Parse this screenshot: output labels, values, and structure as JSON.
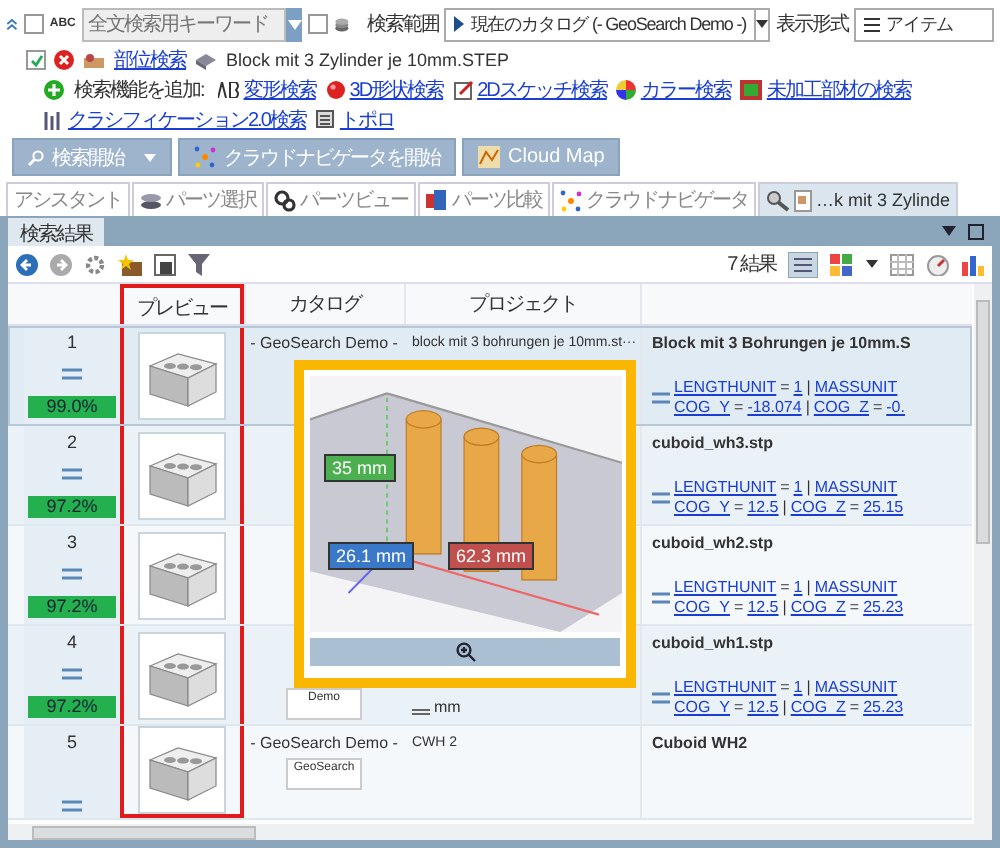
{
  "search_bar": {
    "abc_label": "ABC",
    "keyword_placeholder": "全文検索用キーワード",
    "keyword_checked": false,
    "option_checked": false,
    "scope_label": "検索範囲",
    "scope_value": "現在のカタログ (- GeoSearch Demo -)",
    "view_label": "表示形式",
    "view_value": "アイテム"
  },
  "active_search": {
    "checked": true,
    "link": "部位検索",
    "file": "Block mit 3 Zylinder je 10mm.STEP"
  },
  "add_functions": {
    "label": "検索機能を追加:",
    "links": [
      {
        "kind": "morph",
        "label": "変形検索"
      },
      {
        "kind": "shape3d",
        "label": "3D形状検索"
      },
      {
        "kind": "sketch",
        "label": "2Dスケッチ検索"
      },
      {
        "kind": "color",
        "label": "カラー検索"
      },
      {
        "kind": "raw",
        "label": "未加工部材の検索"
      },
      {
        "kind": "classification",
        "label": "クラシフィケーション2.0検索"
      },
      {
        "kind": "topology",
        "label": "トポロ"
      }
    ]
  },
  "actions": [
    {
      "kind": "search",
      "label": "検索開始",
      "menu": true
    },
    {
      "kind": "cloud",
      "label": "クラウドナビゲータを開始",
      "menu": false
    },
    {
      "kind": "map",
      "label": "Cloud Map",
      "menu": false
    }
  ],
  "tabs": [
    {
      "kind": "assistant",
      "label": "アシスタント",
      "selected": false
    },
    {
      "kind": "parts",
      "label": "パーツ選択",
      "selected": false
    },
    {
      "kind": "view",
      "label": "パーツビュー",
      "selected": false
    },
    {
      "kind": "compare",
      "label": "パーツ比較",
      "selected": false
    },
    {
      "kind": "cloud",
      "label": "クラウドナビゲータ",
      "selected": false
    },
    {
      "kind": "result",
      "label": "…k mit 3 Zylinde",
      "selected": true
    }
  ],
  "panel": {
    "tab": "検索結果",
    "result_count": "7 結果"
  },
  "table": {
    "columns": [
      "プレビュー",
      "カタログ",
      "プロジェクト"
    ],
    "rows": [
      {
        "number": "1",
        "score": "99.0%",
        "selected": true,
        "catalog": "- GeoSearch Demo -",
        "project": "block mit 3 bohrungen je 10mm.st···",
        "title": "Block mit 3 Bohrungen je 10mm.S",
        "props": [
          [
            {
              "kind": "link",
              "text": "LENGTHUNIT"
            },
            {
              "kind": "op",
              "text": "="
            },
            {
              "kind": "link",
              "text": "1"
            },
            {
              "kind": "op",
              "text": "|"
            },
            {
              "kind": "link",
              "text": "MASSUNIT"
            }
          ],
          [
            {
              "kind": "link",
              "text": "COG_Y"
            },
            {
              "kind": "op",
              "text": "="
            },
            {
              "kind": "link",
              "text": "-18.074"
            },
            {
              "kind": "op",
              "text": "|"
            },
            {
              "kind": "link",
              "text": "COG_Z"
            },
            {
              "kind": "op",
              "text": "="
            },
            {
              "kind": "link",
              "text": "-0."
            }
          ]
        ]
      },
      {
        "number": "2",
        "score": "97.2%",
        "selected": false,
        "title": "cuboid_wh3.stp",
        "props": [
          [
            {
              "kind": "link",
              "text": "LENGTHUNIT"
            },
            {
              "kind": "op",
              "text": "="
            },
            {
              "kind": "link",
              "text": "1"
            },
            {
              "kind": "op",
              "text": "|"
            },
            {
              "kind": "link",
              "text": "MASSUNIT"
            }
          ],
          [
            {
              "kind": "link",
              "text": "COG_Y"
            },
            {
              "kind": "op",
              "text": "="
            },
            {
              "kind": "link",
              "text": "12.5"
            },
            {
              "kind": "op",
              "text": "|"
            },
            {
              "kind": "link",
              "text": "COG_Z"
            },
            {
              "kind": "op",
              "text": "="
            },
            {
              "kind": "link",
              "text": "25.15"
            }
          ]
        ]
      },
      {
        "number": "3",
        "score": "97.2%",
        "selected": false,
        "title": "cuboid_wh2.stp",
        "props": [
          [
            {
              "kind": "link",
              "text": "LENGTHUNIT"
            },
            {
              "kind": "op",
              "text": "="
            },
            {
              "kind": "link",
              "text": "1"
            },
            {
              "kind": "op",
              "text": "|"
            },
            {
              "kind": "link",
              "text": "MASSUNIT"
            }
          ],
          [
            {
              "kind": "link",
              "text": "COG_Y"
            },
            {
              "kind": "op",
              "text": "="
            },
            {
              "kind": "link",
              "text": "12.5"
            },
            {
              "kind": "op",
              "text": "|"
            },
            {
              "kind": "link",
              "text": "COG_Z"
            },
            {
              "kind": "op",
              "text": "="
            },
            {
              "kind": "link",
              "text": "25.23"
            }
          ]
        ]
      },
      {
        "number": "4",
        "score": "97.2%",
        "selected": false,
        "catalog_logo": "Demo",
        "project": "mm",
        "title": "cuboid_wh1.stp",
        "props": [
          [
            {
              "kind": "link",
              "text": "LENGTHUNIT"
            },
            {
              "kind": "op",
              "text": "="
            },
            {
              "kind": "link",
              "text": "1"
            },
            {
              "kind": "op",
              "text": "|"
            },
            {
              "kind": "link",
              "text": "MASSUNIT"
            }
          ],
          [
            {
              "kind": "link",
              "text": "COG_Y"
            },
            {
              "kind": "op",
              "text": "="
            },
            {
              "kind": "link",
              "text": "12.5"
            },
            {
              "kind": "op",
              "text": "|"
            },
            {
              "kind": "link",
              "text": "COG_Z"
            },
            {
              "kind": "op",
              "text": "="
            },
            {
              "kind": "link",
              "text": "25.23"
            }
          ]
        ]
      },
      {
        "number": "5",
        "selected": false,
        "catalog": "- GeoSearch Demo -",
        "catalog_logo": "GeoSearch",
        "project": "CWH 2",
        "title": "Cuboid WH2"
      }
    ]
  },
  "preview_popup": {
    "measures": [
      {
        "kind": "height",
        "label": "35 mm",
        "color": "#4caf50"
      },
      {
        "kind": "depth",
        "label": "26.1 mm",
        "color": "#3a78c8"
      },
      {
        "kind": "width",
        "label": "62.3 mm",
        "color": "#c0504d"
      }
    ]
  }
}
